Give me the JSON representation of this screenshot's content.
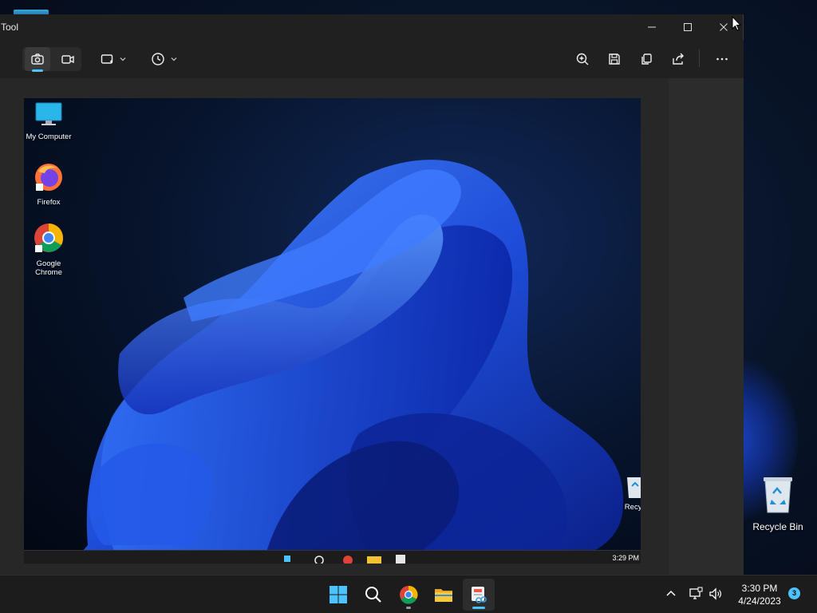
{
  "window": {
    "title": "Tool",
    "caption": {
      "minimize": "minimize-icon",
      "maximize": "maximize-icon",
      "close": "close-icon"
    }
  },
  "toolbar": {
    "modes": [
      {
        "name": "snip-mode",
        "icon": "camera-icon",
        "active": true
      },
      {
        "name": "record-mode",
        "icon": "video-icon",
        "active": false
      }
    ],
    "shape_icon": "rectangle-snip-icon",
    "delay_icon": "clock-icon",
    "actions": [
      "zoom-in-icon",
      "save-icon",
      "copy-icon",
      "share-icon",
      "more-icon"
    ]
  },
  "capture": {
    "desktop_icons": [
      {
        "label": "My Computer"
      },
      {
        "label": "Firefox"
      },
      {
        "label": "Google Chrome"
      }
    ],
    "recycle_label": "Recyc",
    "taskbar_time": "3:29 PM"
  },
  "desktop": {
    "recycle_bin": "Recycle Bin"
  },
  "taskbar": {
    "apps": [
      {
        "name": "start",
        "icon": "windows-logo-icon"
      },
      {
        "name": "search",
        "icon": "search-icon"
      },
      {
        "name": "chrome",
        "icon": "chrome-icon"
      },
      {
        "name": "file-explorer",
        "icon": "folder-icon"
      },
      {
        "name": "snipping-tool",
        "icon": "snipping-tool-icon"
      }
    ],
    "time": "3:30 PM",
    "date": "4/24/2023",
    "notifications": "3"
  },
  "colors": {
    "accent": "#4cc2ff",
    "window_bg": "#202020",
    "taskbar_bg": "#1c1c1c"
  }
}
